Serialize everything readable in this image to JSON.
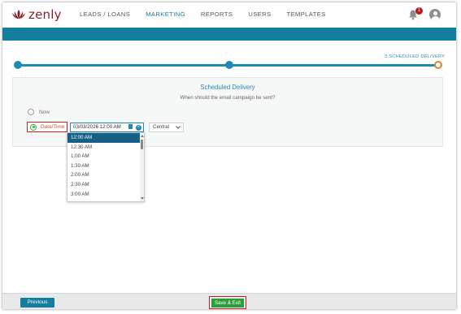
{
  "app": {
    "logo_text": "zenly",
    "brand_color": "#8c1c1c",
    "accent_color": "#137e9e"
  },
  "nav": {
    "items": [
      {
        "label": "LEADS / LOANS",
        "active": false
      },
      {
        "label": "MARKETING",
        "active": true
      },
      {
        "label": "REPORTS",
        "active": false
      },
      {
        "label": "USERS",
        "active": false
      },
      {
        "label": "TEMPLATES",
        "active": false
      }
    ]
  },
  "notifications": {
    "count": "1",
    "icon": "bell-icon"
  },
  "user": {
    "icon": "user-avatar-icon"
  },
  "stepper": {
    "current_step_label": "3.SCHEDULED DELIVERY",
    "steps_total": 3,
    "current_step": 3
  },
  "schedule": {
    "title": "Scheduled Delivery",
    "question": "When should the email campaign be sent?",
    "option_now": "Now",
    "option_datetime": "Date/Time",
    "selected_option": "Date/Time",
    "datetime_value": "03/03/2026 12:00 AM",
    "clear_symbol": "×",
    "timezone": "Central"
  },
  "time_list": {
    "items": [
      "12:00 AM",
      "12:30 AM",
      "1:00 AM",
      "1:30 AM",
      "2:00 AM",
      "2:30 AM",
      "3:00 AM"
    ],
    "selected": "12:00 AM"
  },
  "footer": {
    "previous_label": "Previous",
    "save_exit_label": "Save & Exit"
  }
}
